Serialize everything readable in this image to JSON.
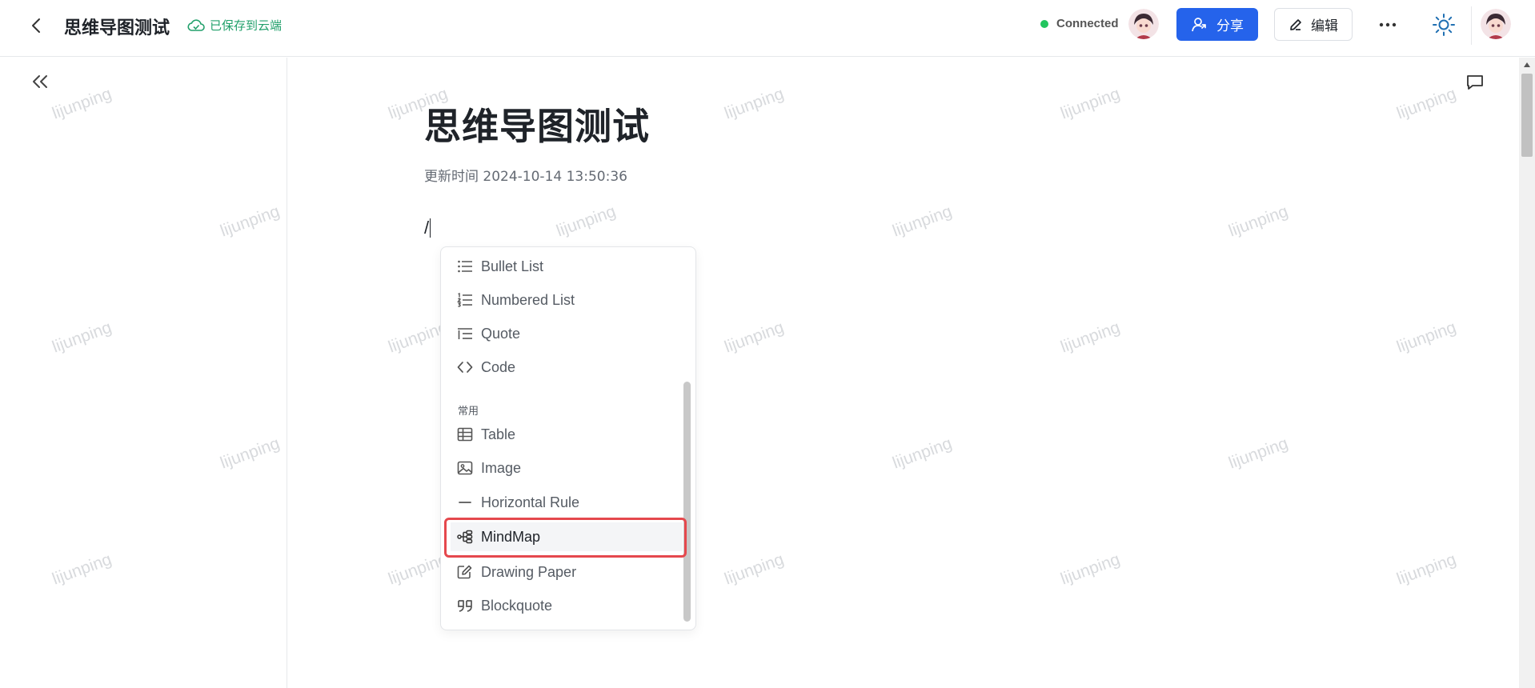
{
  "header": {
    "title": "思维导图测试",
    "save_status": "已保存到云端",
    "connection": "Connected",
    "share_label": "分享",
    "edit_label": "编辑"
  },
  "document": {
    "heading": "思维导图测试",
    "updated": "更新时间 2024-10-14 13:50:36",
    "typed": "/"
  },
  "menu": {
    "section": "常用",
    "items": [
      {
        "label": "Bullet List",
        "icon": "bullet-list-icon"
      },
      {
        "label": "Numbered List",
        "icon": "numbered-list-icon"
      },
      {
        "label": "Quote",
        "icon": "quote-icon"
      },
      {
        "label": "Code",
        "icon": "code-icon"
      },
      {
        "label": "Table",
        "icon": "table-icon"
      },
      {
        "label": "Image",
        "icon": "image-icon"
      },
      {
        "label": "Horizontal Rule",
        "icon": "horizontal-rule-icon"
      },
      {
        "label": "MindMap",
        "icon": "mindmap-icon"
      },
      {
        "label": "Drawing Paper",
        "icon": "drawing-paper-icon"
      },
      {
        "label": "Blockquote",
        "icon": "blockquote-icon"
      }
    ],
    "highlighted": "MindMap"
  },
  "watermark": "lijunping",
  "colors": {
    "primary": "#2563eb",
    "saved": "#22a06b",
    "connected": "#22c55e",
    "highlight": "#e5484d"
  }
}
